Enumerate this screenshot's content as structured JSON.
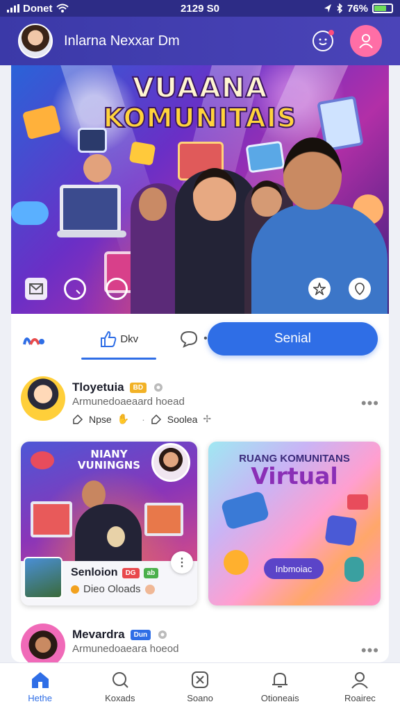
{
  "status_bar": {
    "carrier": "Donet",
    "time": "2129 S0",
    "battery": "76%"
  },
  "header": {
    "title": "Inlarna Nexxar Dm"
  },
  "hero": {
    "line1": "VUAANA",
    "line2": "KOMUNITAIS"
  },
  "actions": {
    "like_label": "Dkv",
    "send_label": "Senial"
  },
  "posts": [
    {
      "name": "Tloyetuia",
      "badge": "BD",
      "subtitle": "Armunedoaeaard hoead",
      "meta1": "Npse",
      "meta2": "Soolea"
    },
    {
      "name": "Mevardra",
      "badge": "Dun",
      "subtitle": "Armunedoaeara hoeod"
    }
  ],
  "tiles": [
    {
      "top_text": "NIANY VUNINGNS",
      "title": "Senloion",
      "badge1": "DG",
      "badge2": "ab",
      "subtitle": "Dieo Oloads"
    },
    {
      "title": "RUANG KOMUNITANS",
      "subtitle": "Virtual",
      "button": "Inbmoiac"
    }
  ],
  "nav": [
    {
      "label": "Hethe",
      "icon": "home-icon",
      "active": true
    },
    {
      "label": "Koxads",
      "icon": "search-chat-icon",
      "active": false
    },
    {
      "label": "Soano",
      "icon": "close-box-icon",
      "active": false
    },
    {
      "label": "Otioneais",
      "icon": "bell-icon",
      "active": false
    },
    {
      "label": "Roairec",
      "icon": "user-icon",
      "active": false
    }
  ],
  "colors": {
    "header": "#3b39a8",
    "accent": "#2f6ee6",
    "profile": "#ff6ea6"
  }
}
